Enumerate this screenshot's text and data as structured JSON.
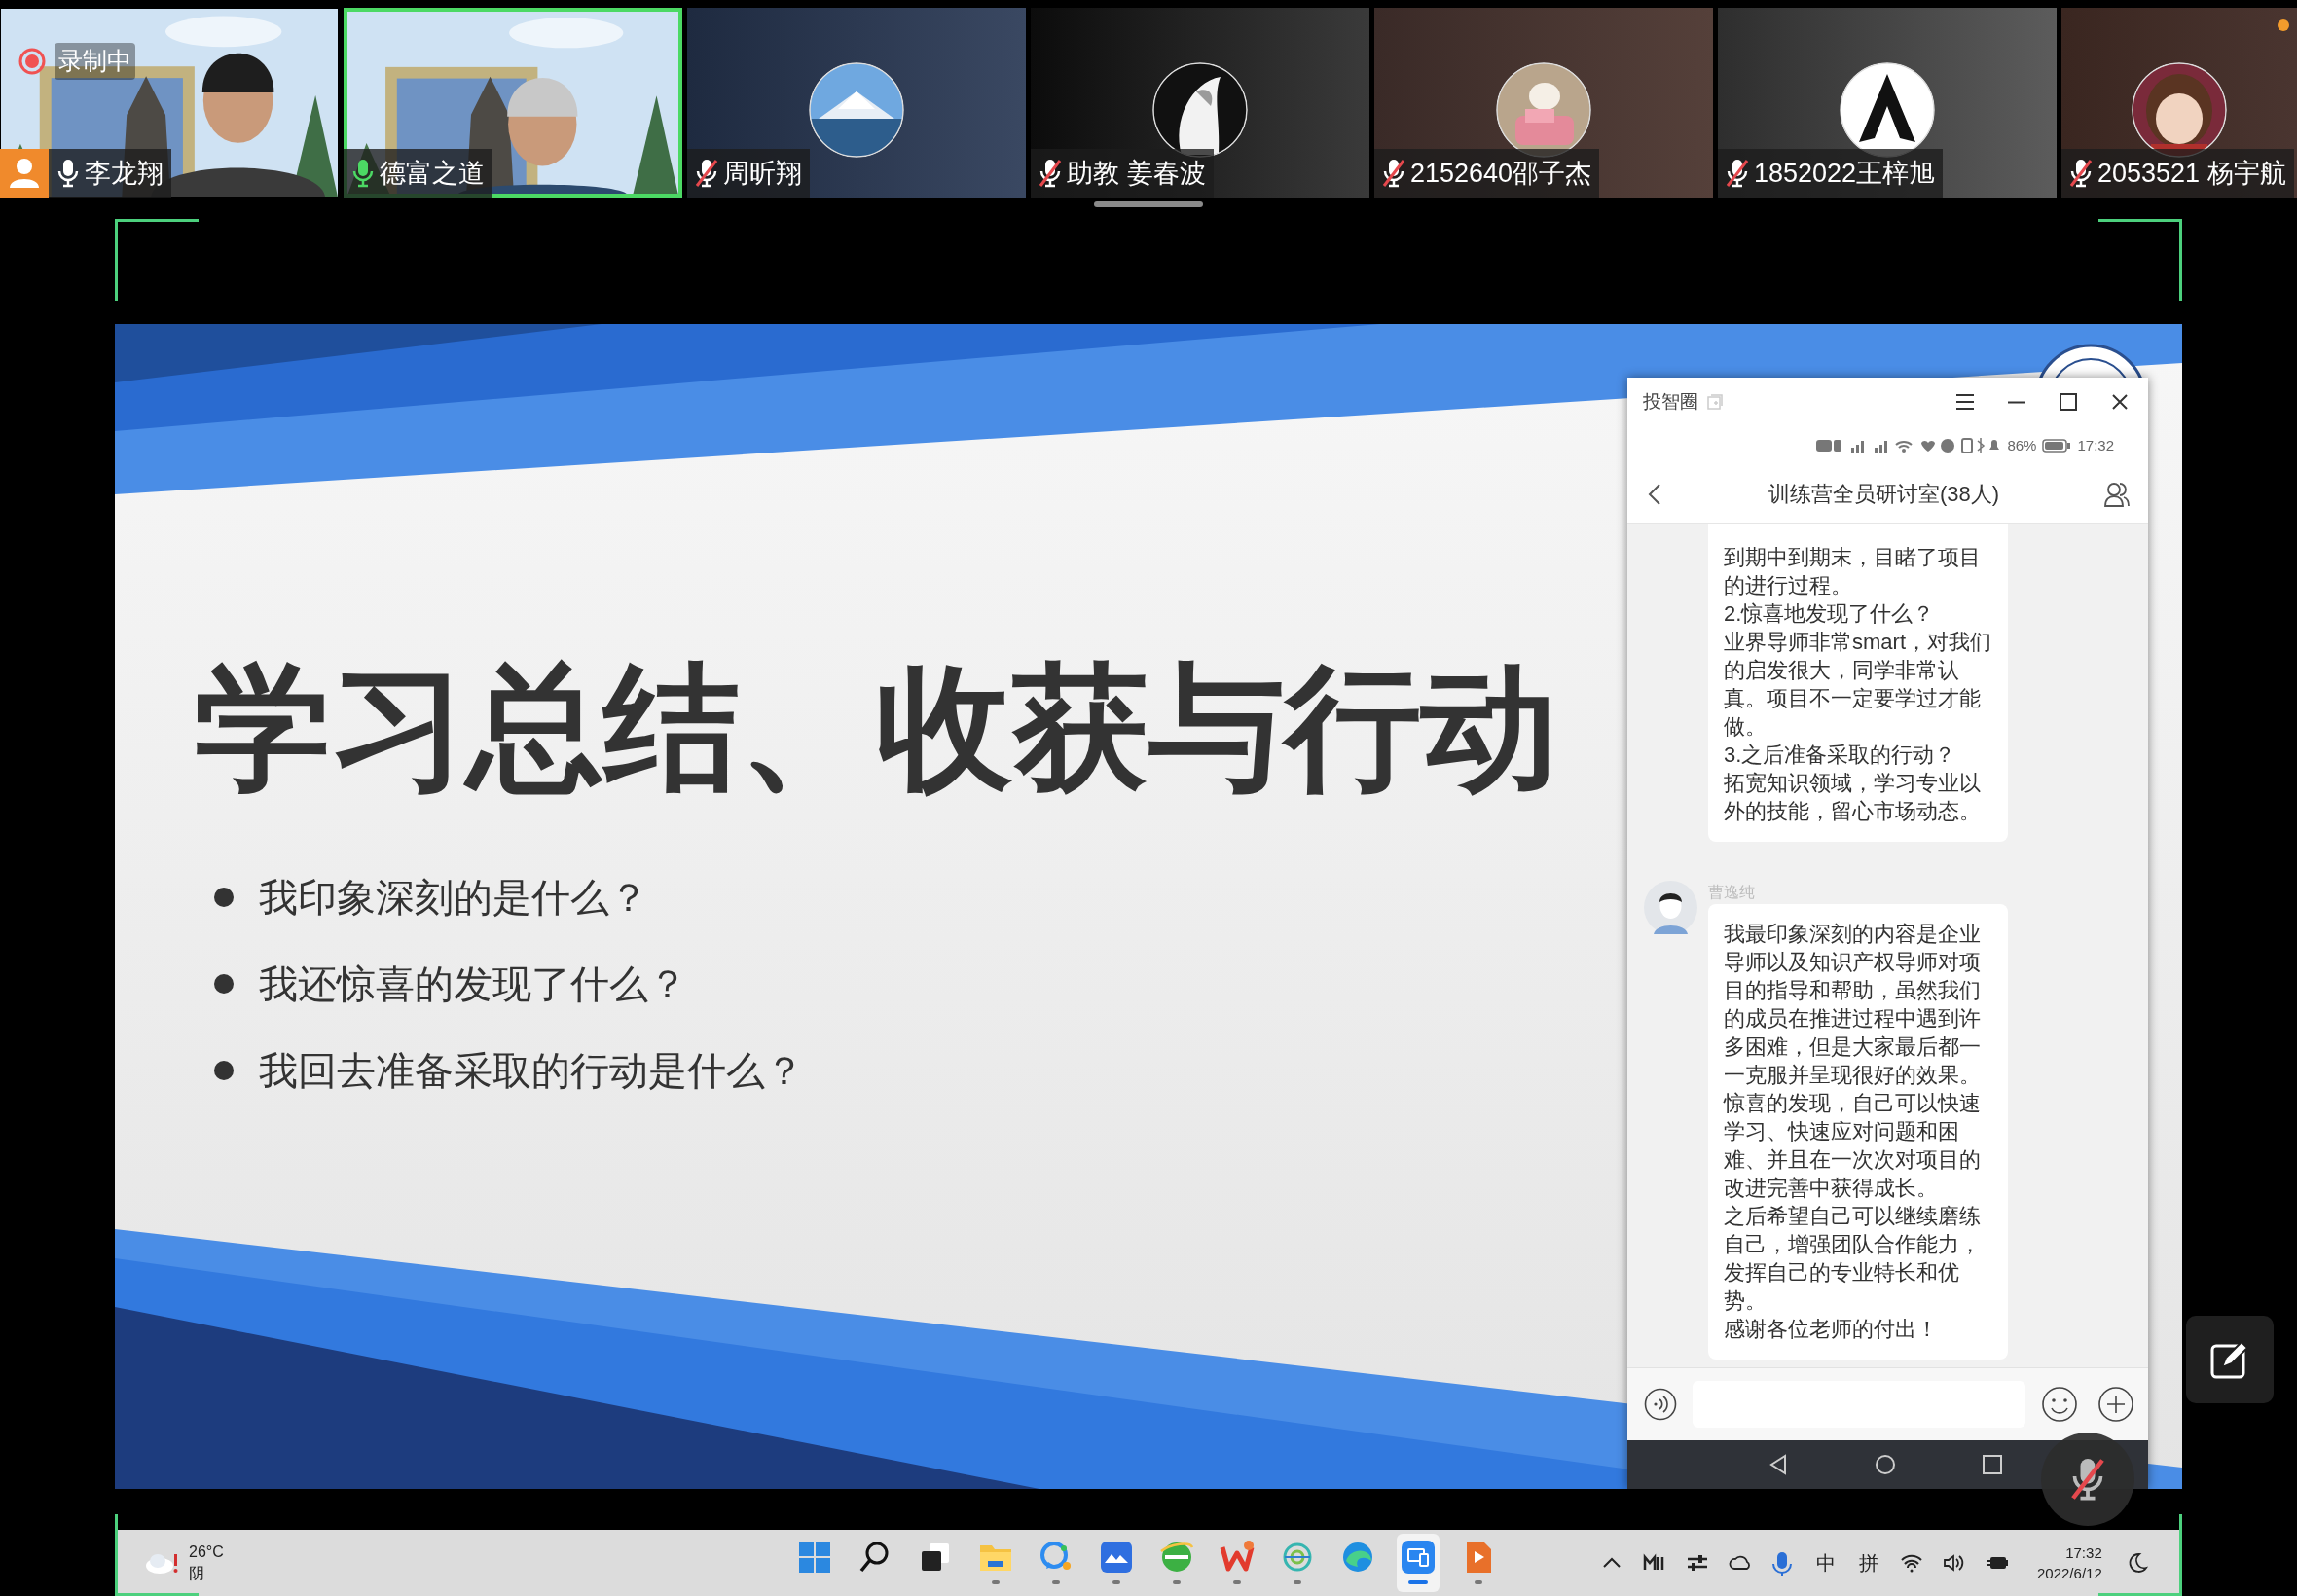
{
  "meeting": {
    "recording": "录制中",
    "self_mic": {
      "muted": true
    }
  },
  "participants": [
    {
      "name": "李龙翔",
      "kind": "video",
      "muted": false,
      "speaking": false,
      "host": true,
      "alert": false
    },
    {
      "name": "德富之道",
      "kind": "video",
      "muted": false,
      "speaking": true,
      "host": false,
      "alert": false
    },
    {
      "name": "周昕翔",
      "kind": "avatar",
      "muted": true,
      "speaking": false,
      "host": false,
      "alert": false
    },
    {
      "name": "助教 姜春波",
      "kind": "avatar",
      "muted": true,
      "speaking": false,
      "host": false,
      "alert": false
    },
    {
      "name": "2152640邵子杰",
      "kind": "avatar",
      "muted": true,
      "speaking": false,
      "host": false,
      "alert": false
    },
    {
      "name": "1852022王梓旭",
      "kind": "avatar",
      "muted": true,
      "speaking": false,
      "host": false,
      "alert": false
    },
    {
      "name": "2053521 杨宇航",
      "kind": "avatar",
      "muted": true,
      "speaking": false,
      "host": false,
      "alert": true
    }
  ],
  "slide": {
    "title": "学习总结、收获与行动",
    "bullets": [
      "我印象深刻的是什么？",
      "我还惊喜的发现了什么？",
      "我回去准备采取的行动是什么？"
    ]
  },
  "chat_window": {
    "app_title": "投智圈",
    "phone_status": {
      "battery": "86%",
      "time": "17:32"
    },
    "room_title": "训练营全员研讨室(38人)",
    "messages": [
      {
        "paragraphs": [
          "到期中到期末，目睹了项目的进行过程。",
          "2.惊喜地发现了什么？",
          "业界导师非常smart，对我们的启发很大，同学非常认真。项目不一定要学过才能做。",
          "3.之后准备采取的行动？",
          "拓宽知识领域，学习专业以外的技能，留心市场动态。"
        ]
      },
      {
        "sender": "曹逸纯",
        "paragraphs": [
          "我最印象深刻的内容是企业导师以及知识产权导师对项目的指导和帮助，虽然我们的成员在推进过程中遇到许多困难，但是大家最后都一一克服并呈现很好的效果。",
          "惊喜的发现，自己可以快速学习、快速应对问题和困难、并且在一次次对项目的改进完善中获得成长。",
          "之后希望自己可以继续磨练自己，增强团队合作能力，发挥自己的专业特长和优势。",
          "感谢各位老师的付出！"
        ]
      }
    ]
  },
  "taskbar": {
    "weather": {
      "temperature": "26°C",
      "condition": "阴"
    },
    "apps": [
      {
        "kind": "start",
        "running": false,
        "selected": false
      },
      {
        "kind": "search",
        "running": false,
        "selected": false
      },
      {
        "kind": "task-view",
        "running": false,
        "selected": false
      },
      {
        "kind": "folder",
        "running": true,
        "selected": false
      },
      {
        "kind": "chat",
        "running": true,
        "selected": false
      },
      {
        "kind": "cloud",
        "running": true,
        "selected": false
      },
      {
        "kind": "globe",
        "running": true,
        "selected": false
      },
      {
        "kind": "office",
        "running": true,
        "selected": false
      },
      {
        "kind": "swirl",
        "running": true,
        "selected": false
      },
      {
        "kind": "browser",
        "running": false,
        "selected": false
      },
      {
        "kind": "screen",
        "running": true,
        "selected": true
      },
      {
        "kind": "player",
        "running": true,
        "selected": false
      }
    ],
    "tray": {
      "ime_mode": "中",
      "ime": "拼",
      "time": "17:32",
      "date": "2022/6/12"
    }
  }
}
